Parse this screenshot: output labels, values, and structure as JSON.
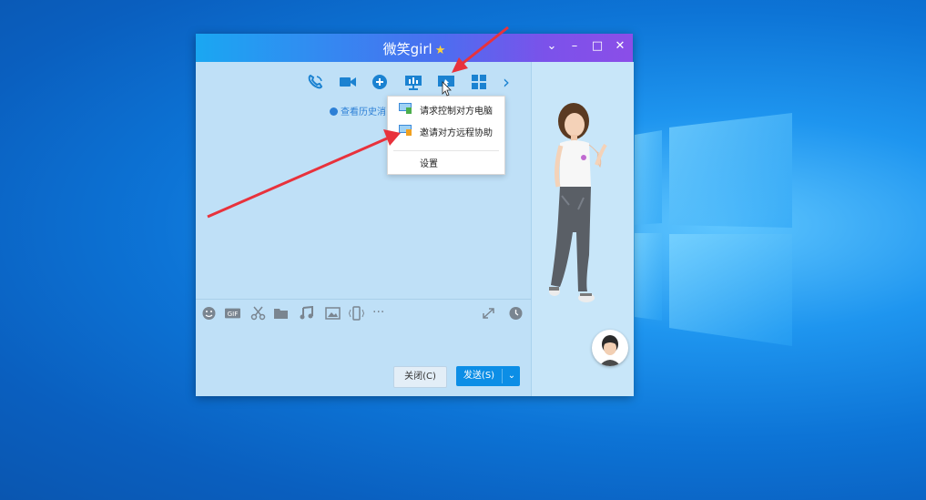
{
  "window": {
    "title": "微笑girl",
    "title_star": "★",
    "controls": {
      "minimize": "–",
      "maximize": "□",
      "close": "✕",
      "collapse": "⌄"
    }
  },
  "toolbar": {
    "icons": [
      "voice-call-icon",
      "video-call-icon",
      "add-member-icon",
      "share-screen-icon",
      "remote-assist-icon",
      "apps-icon",
      "more-arrow-icon"
    ],
    "next": "›"
  },
  "history": {
    "label": "查看历史消"
  },
  "dropdown_menu": {
    "items": [
      {
        "label": "请求控制对方电脑",
        "icon": "remote-control-icon"
      },
      {
        "label": "邀请对方远程协助",
        "icon": "invite-assist-icon"
      },
      {
        "label": "设置",
        "icon": ""
      }
    ]
  },
  "input_tools": [
    "emoji-icon",
    "gif-icon",
    "scissors-icon",
    "folder-icon",
    "music-icon",
    "image-icon",
    "shake-icon",
    "more-dots-icon",
    "expand-icon",
    "history-clock-icon"
  ],
  "input_tool_text": {
    "gif": "GIF",
    "more": "···"
  },
  "buttons": {
    "close": "关闭(C)",
    "send": "发送(S)",
    "send_arrow": "⌄"
  },
  "colors": {
    "accent": "#0c8ee6",
    "title_gradient_start": "#1aa7f2",
    "title_gradient_end": "#8b4ee8",
    "annotation_arrow": "#e8323c"
  }
}
